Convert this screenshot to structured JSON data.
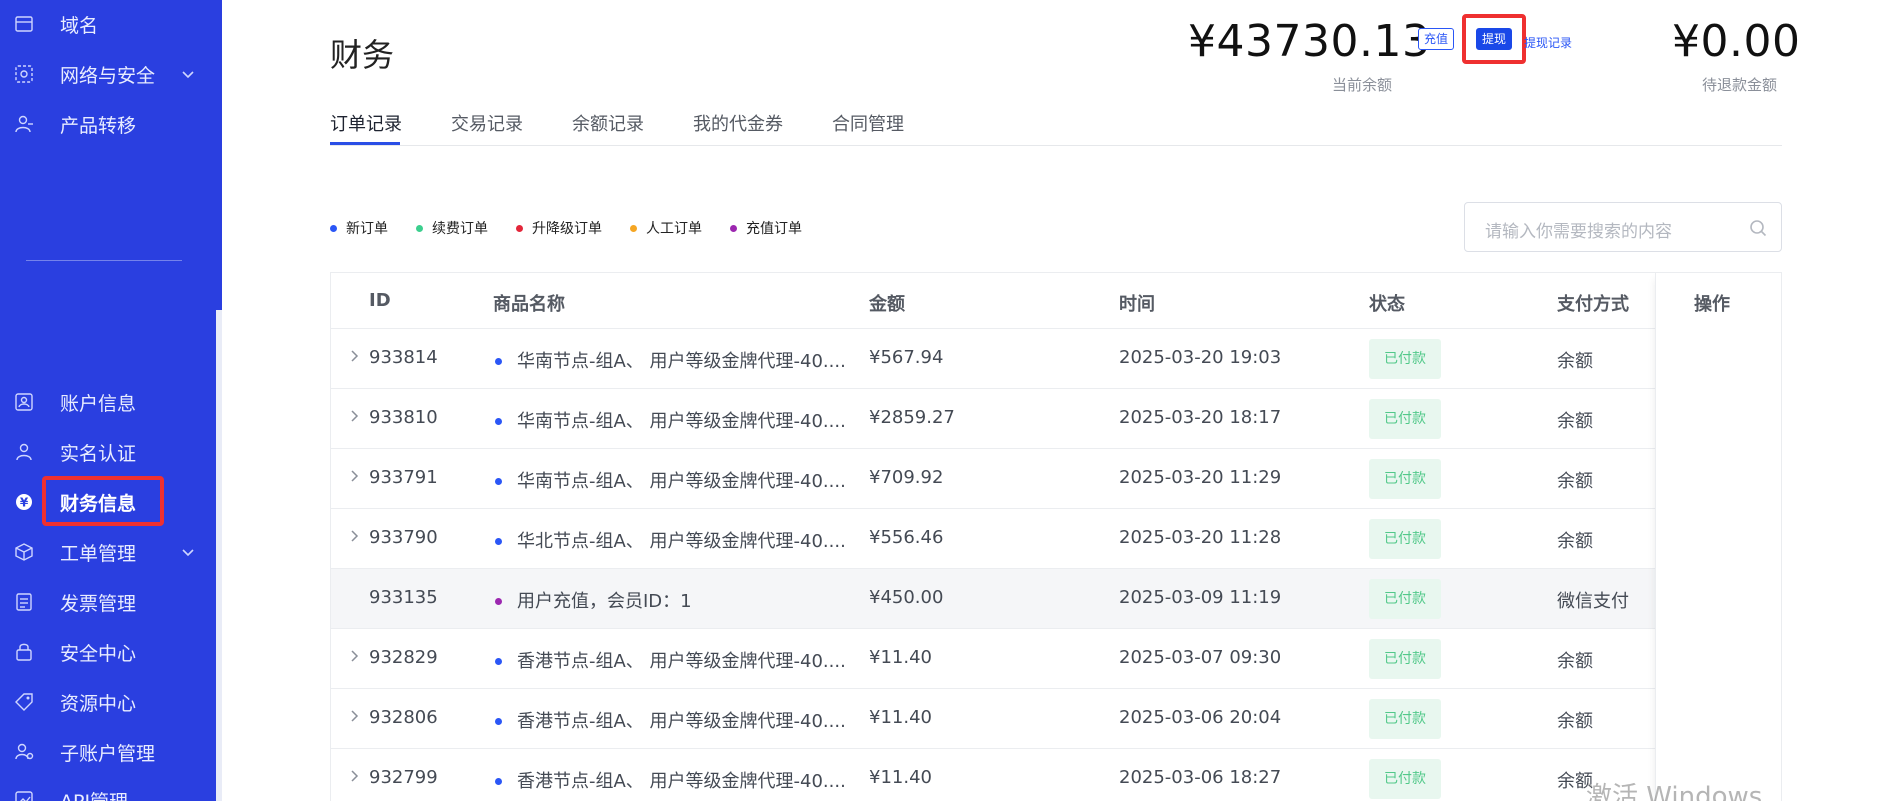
{
  "sidebar": {
    "items_top": [
      {
        "label": "域名",
        "icon": "domain-icon"
      },
      {
        "label": "网络与安全",
        "icon": "network-security-icon"
      },
      {
        "label": "产品转移",
        "icon": "product-transfer-icon"
      }
    ],
    "items_bottom": [
      {
        "label": "账户信息",
        "icon": "account-icon"
      },
      {
        "label": "实名认证",
        "icon": "user-verify-icon"
      },
      {
        "label": "财务信息",
        "icon": "finance-icon"
      },
      {
        "label": "工单管理",
        "icon": "ticket-icon"
      },
      {
        "label": "发票管理",
        "icon": "invoice-icon"
      },
      {
        "label": "安全中心",
        "icon": "security-center-icon"
      },
      {
        "label": "资源中心",
        "icon": "resource-center-icon"
      },
      {
        "label": "子账户管理",
        "icon": "sub-account-icon"
      },
      {
        "label": "API管理",
        "icon": "api-icon"
      }
    ],
    "active_item": "财务信息",
    "accent": "#2a3fe0"
  },
  "header": {
    "title": "财务",
    "balance": "¥43730.13",
    "balance_label": "当前余额",
    "recharge_label": "充值",
    "withdraw_label": "提现",
    "withdraw_records_label": "提现记录",
    "refund": "¥0.00",
    "refund_label": "待退款金额"
  },
  "tabs": [
    "订单记录",
    "交易记录",
    "余额记录",
    "我的代金券",
    "合同管理"
  ],
  "legend": [
    {
      "label": "新订单",
      "color": "#2a56f6"
    },
    {
      "label": "续费订单",
      "color": "#3ccf8e"
    },
    {
      "label": "升降级订单",
      "color": "#e3263a"
    },
    {
      "label": "人工订单",
      "color": "#f5a623"
    },
    {
      "label": "充值订单",
      "color": "#9c27b0"
    }
  ],
  "search": {
    "placeholder": "请输入你需要搜索的内容"
  },
  "table": {
    "columns": [
      "ID",
      "商品名称",
      "金额",
      "时间",
      "状态",
      "支付方式",
      "操作"
    ],
    "rows": [
      {
        "id": "933814",
        "name": "华南节点-组A、 用户等级金牌代理-40....",
        "amount": "¥567.94",
        "time": "2025-03-20 19:03",
        "status": "已付款",
        "pay": "余额",
        "dot": "#2a56f6",
        "expand": true
      },
      {
        "id": "933810",
        "name": "华南节点-组A、 用户等级金牌代理-40....",
        "amount": "¥2859.27",
        "time": "2025-03-20 18:17",
        "status": "已付款",
        "pay": "余额",
        "dot": "#2a56f6",
        "expand": true
      },
      {
        "id": "933791",
        "name": "华南节点-组A、 用户等级金牌代理-40....",
        "amount": "¥709.92",
        "time": "2025-03-20 11:29",
        "status": "已付款",
        "pay": "余额",
        "dot": "#2a56f6",
        "expand": true
      },
      {
        "id": "933790",
        "name": "华北节点-组A、 用户等级金牌代理-40....",
        "amount": "¥556.46",
        "time": "2025-03-20 11:28",
        "status": "已付款",
        "pay": "余额",
        "dot": "#2a56f6",
        "expand": true
      },
      {
        "id": "933135",
        "name": "用户充值，会员ID：1",
        "amount": "¥450.00",
        "time": "2025-03-09 11:19",
        "status": "已付款",
        "pay": "微信支付",
        "dot": "#9c27b0",
        "expand": false
      },
      {
        "id": "932829",
        "name": "香港节点-组A、 用户等级金牌代理-40....",
        "amount": "¥11.40",
        "time": "2025-03-07 09:30",
        "status": "已付款",
        "pay": "余额",
        "dot": "#2a56f6",
        "expand": true
      },
      {
        "id": "932806",
        "name": "香港节点-组A、 用户等级金牌代理-40....",
        "amount": "¥11.40",
        "time": "2025-03-06 20:04",
        "status": "已付款",
        "pay": "余额",
        "dot": "#2a56f6",
        "expand": true
      },
      {
        "id": "932799",
        "name": "香港节点-组A、 用户等级金牌代理-40....",
        "amount": "¥11.40",
        "time": "2025-03-06 18:27",
        "status": "已付款",
        "pay": "余额",
        "dot": "#2a56f6",
        "expand": true
      }
    ]
  },
  "watermark": "激活 Windows"
}
